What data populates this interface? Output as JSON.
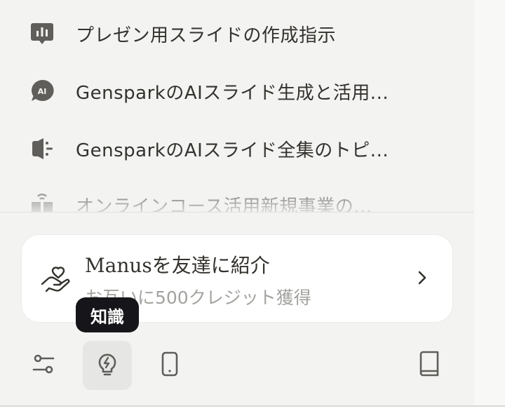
{
  "tasks": [
    {
      "title": "プレゼン用スライドの作成指示",
      "icon": "chart-bubble-icon"
    },
    {
      "title": "GensparkのAIスライド生成と活用...",
      "icon": "ai-bubble-icon"
    },
    {
      "title": "GensparkのAIスライド全集のトピ...",
      "icon": "megaphone-icon"
    },
    {
      "title": "オンラインコース活用新規事業の...",
      "icon": "book-signal-icon"
    }
  ],
  "referral": {
    "title": "Manusを友達に紹介",
    "subtitle": "お互いに500クレジット獲得",
    "icon": "hand-heart-icon"
  },
  "tooltip": {
    "text": "知識"
  },
  "toolbar": {
    "items": [
      {
        "name": "settings-sliders",
        "icon": "sliders-icon"
      },
      {
        "name": "knowledge",
        "icon": "lightbulb-icon",
        "active": true
      },
      {
        "name": "mobile",
        "icon": "phone-icon"
      },
      {
        "name": "docs",
        "icon": "book-icon"
      }
    ]
  },
  "colors": {
    "panel": "#f3f3f2",
    "text": "#34322d",
    "muted": "#a3a29e",
    "card": "#ffffff",
    "tooltip": "#16161a"
  }
}
